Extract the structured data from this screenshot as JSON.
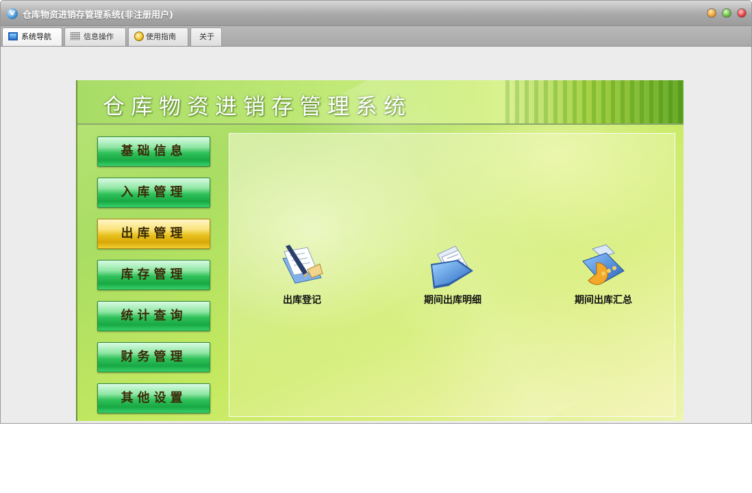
{
  "window": {
    "title": "仓库物资进销存管理系统(非注册用户)"
  },
  "tabs": [
    {
      "label": "系统导航",
      "icon": "monitor-icon",
      "active": true
    },
    {
      "label": "信息操作",
      "icon": "grid-icon",
      "active": false
    },
    {
      "label": "使用指南",
      "icon": "help-icon",
      "active": false
    },
    {
      "label": "关于",
      "icon": "",
      "active": false
    }
  ],
  "banner": {
    "title": "仓库物资进销存管理系统"
  },
  "nav": {
    "items": [
      {
        "label": "基础信息",
        "active": false
      },
      {
        "label": "入库管理",
        "active": false
      },
      {
        "label": "出库管理",
        "active": true
      },
      {
        "label": "库存管理",
        "active": false
      },
      {
        "label": "统计查询",
        "active": false
      },
      {
        "label": "财务管理",
        "active": false
      },
      {
        "label": "其他设置",
        "active": false
      }
    ]
  },
  "content": {
    "items": [
      {
        "label": "出库登记",
        "icon": "document-edit-icon"
      },
      {
        "label": "期间出库明细",
        "icon": "folder-documents-icon"
      },
      {
        "label": "期间出库汇总",
        "icon": "chart-folder-icon"
      }
    ]
  },
  "colors": {
    "accent_green": "#2fc15a",
    "active_yellow": "#e8c11e",
    "title_bar": "#a9a9a9"
  }
}
